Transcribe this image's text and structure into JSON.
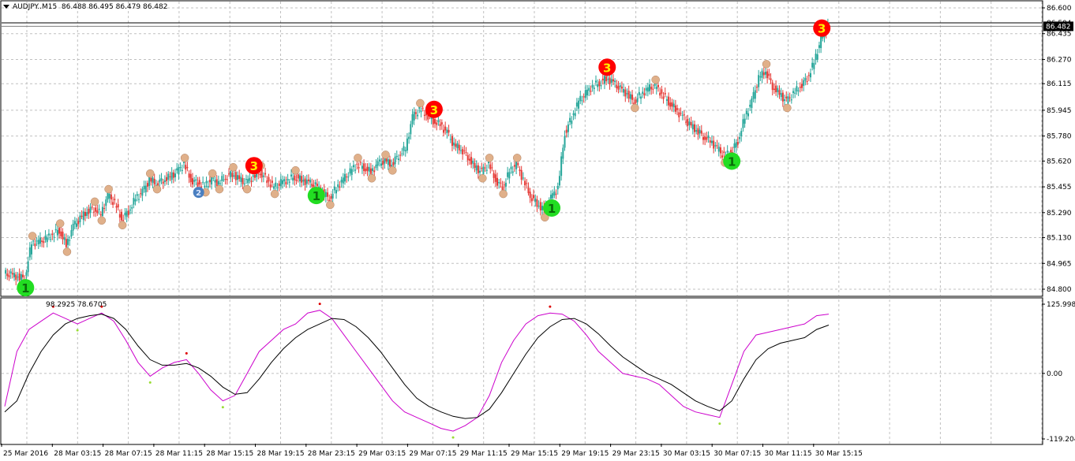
{
  "header": {
    "symbol": "AUDJPY..M15",
    "ohlc": "86.488 86.495 86.479 86.482"
  },
  "indicator_header": {
    "values": "98.2925 78.6705"
  },
  "price_axis": {
    "ticks": [
      "86.600",
      "86.435",
      "86.270",
      "86.115",
      "85.945",
      "85.780",
      "85.620",
      "85.455",
      "85.290",
      "85.130",
      "84.965",
      "84.800"
    ],
    "current_price": "86.482",
    "upper_level": "86.504"
  },
  "indicator_axis": {
    "ticks": [
      "125.9988",
      "0.00",
      "-119.204"
    ]
  },
  "time_axis": {
    "ticks": [
      "25 Mar 2016",
      "28 Mar 03:15",
      "28 Mar 07:15",
      "28 Mar 11:15",
      "28 Mar 15:15",
      "28 Mar 19:15",
      "28 Mar 23:15",
      "29 Mar 03:15",
      "29 Mar 07:15",
      "29 Mar 11:15",
      "29 Mar 15:15",
      "29 Mar 19:15",
      "29 Mar 23:15",
      "30 Mar 03:15",
      "30 Mar 07:15",
      "30 Mar 11:15",
      "30 Mar 15:15"
    ]
  },
  "colors": {
    "bull": "#26a69a",
    "bear": "#e53935",
    "grid": "#c0c0c0",
    "osc_fast": "#cc00cc",
    "osc_slow": "#000000",
    "marker_tan": "#e0b08a",
    "marker_red": "#ff0000",
    "marker_green": "#22dd22",
    "marker_blue": "#4a7fc0",
    "marker_yellow": "#ffee33"
  },
  "chart_data": {
    "type": "candlestick",
    "price_series": [
      84.9,
      84.89,
      84.88,
      84.87,
      85.1,
      85.1,
      85.12,
      85.15,
      85.18,
      85.08,
      85.2,
      85.25,
      85.3,
      85.32,
      85.28,
      85.4,
      85.35,
      85.25,
      85.3,
      85.38,
      85.42,
      85.5,
      85.48,
      85.5,
      85.52,
      85.55,
      85.6,
      85.5,
      85.48,
      85.46,
      85.5,
      85.48,
      85.52,
      85.54,
      85.5,
      85.48,
      85.52,
      85.55,
      85.5,
      85.45,
      85.48,
      85.5,
      85.52,
      85.5,
      85.48,
      85.46,
      85.42,
      85.38,
      85.45,
      85.5,
      85.55,
      85.6,
      85.58,
      85.55,
      85.6,
      85.62,
      85.6,
      85.66,
      85.7,
      85.9,
      85.95,
      85.92,
      85.88,
      85.85,
      85.8,
      85.72,
      85.7,
      85.65,
      85.58,
      85.55,
      85.6,
      85.5,
      85.45,
      85.55,
      85.6,
      85.5,
      85.4,
      85.35,
      85.3,
      85.38,
      85.45,
      85.8,
      85.9,
      86.0,
      86.05,
      86.1,
      86.12,
      86.15,
      86.12,
      86.08,
      86.05,
      86.0,
      86.05,
      86.08,
      86.1,
      86.05,
      86.0,
      85.95,
      85.9,
      85.85,
      85.82,
      85.78,
      85.75,
      85.7,
      85.65,
      85.68,
      85.75,
      85.9,
      86.0,
      86.15,
      86.2,
      86.1,
      86.05,
      86.0,
      86.05,
      86.1,
      86.15,
      86.25,
      86.4,
      86.48
    ],
    "osc_fast": [
      -60,
      40,
      80,
      95,
      110,
      100,
      90,
      100,
      110,
      95,
      60,
      20,
      -5,
      10,
      20,
      25,
      0,
      -30,
      -50,
      -40,
      0,
      40,
      60,
      80,
      90,
      110,
      115,
      100,
      70,
      40,
      10,
      -20,
      -50,
      -70,
      -80,
      -90,
      -100,
      -105,
      -95,
      -80,
      -40,
      20,
      60,
      90,
      105,
      110,
      108,
      95,
      70,
      40,
      20,
      0,
      -5,
      -10,
      -20,
      -40,
      -60,
      -70,
      -75,
      -80,
      -20,
      40,
      70,
      75,
      80,
      85,
      90,
      105,
      108
    ],
    "osc_slow": [
      -70,
      -50,
      0,
      40,
      70,
      90,
      100,
      105,
      108,
      100,
      80,
      50,
      25,
      15,
      15,
      18,
      10,
      -5,
      -25,
      -38,
      -35,
      -10,
      20,
      45,
      65,
      80,
      90,
      100,
      98,
      85,
      65,
      40,
      10,
      -20,
      -45,
      -60,
      -70,
      -78,
      -82,
      -80,
      -65,
      -35,
      0,
      35,
      65,
      85,
      98,
      100,
      90,
      72,
      50,
      30,
      15,
      0,
      -10,
      -20,
      -35,
      -50,
      -60,
      -68,
      -50,
      -10,
      25,
      45,
      55,
      60,
      65,
      80,
      88
    ],
    "wave_labels": [
      {
        "label": "1",
        "kind": "green",
        "index": 3
      },
      {
        "label": "2",
        "kind": "blue",
        "index": 28
      },
      {
        "label": "3",
        "kind": "red",
        "index": 36
      },
      {
        "label": "1",
        "kind": "green",
        "index": 45
      },
      {
        "label": "3",
        "kind": "red",
        "index": 62
      },
      {
        "label": "1",
        "kind": "green",
        "index": 79
      },
      {
        "label": "3",
        "kind": "red",
        "index": 87
      },
      {
        "label": "1",
        "kind": "green",
        "index": 105
      },
      {
        "label": "3",
        "kind": "red",
        "index": 118
      }
    ]
  }
}
